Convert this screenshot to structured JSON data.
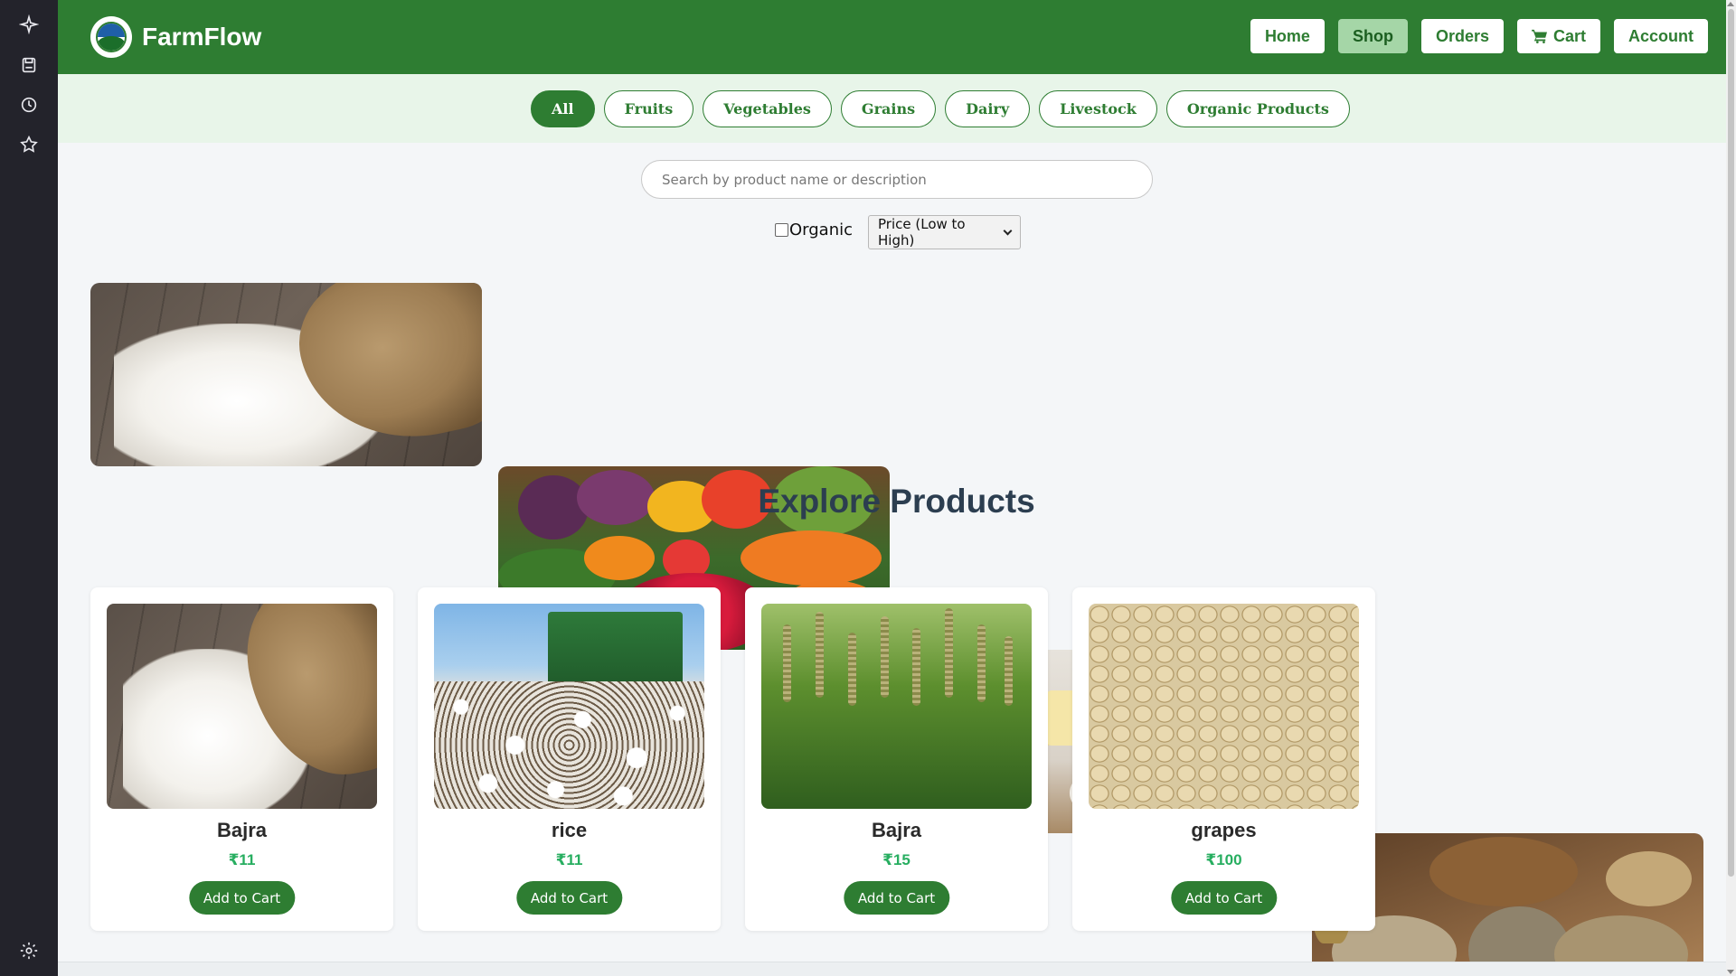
{
  "rail": {
    "icons": [
      "sparkle-icon",
      "save-icon",
      "history-icon",
      "star-icon",
      "settings-icon"
    ]
  },
  "header": {
    "brand": "FarmFlow",
    "nav": {
      "home": "Home",
      "shop": "Shop",
      "orders": "Orders",
      "cart": "Cart",
      "account": "Account"
    },
    "active_nav": "Shop"
  },
  "categories": {
    "items": [
      "All",
      "Fruits",
      "Vegetables",
      "Grains",
      "Dairy",
      "Livestock",
      "Organic Products"
    ],
    "active": "All"
  },
  "filters": {
    "search_placeholder": "Search by product name or description",
    "search_value": "",
    "organic_label": "Organic",
    "organic_checked": false,
    "sort_selected": "Price (Low to High)"
  },
  "section_title": "Explore Products",
  "products": [
    {
      "name": "Bajra",
      "price": "₹11",
      "image": "rice-sack",
      "button": "Add to Cart"
    },
    {
      "name": "rice",
      "price": "₹11",
      "image": "cotton-field",
      "button": "Add to Cart"
    },
    {
      "name": "Bajra",
      "price": "₹15",
      "image": "millet-field",
      "button": "Add to Cart"
    },
    {
      "name": "grapes",
      "price": "₹100",
      "image": "soybeans",
      "button": "Add to Cart"
    }
  ],
  "colors": {
    "primary": "#2e7d32",
    "category_bar": "#e8f5e9",
    "price": "#27ae60",
    "title": "#2c3e50"
  }
}
